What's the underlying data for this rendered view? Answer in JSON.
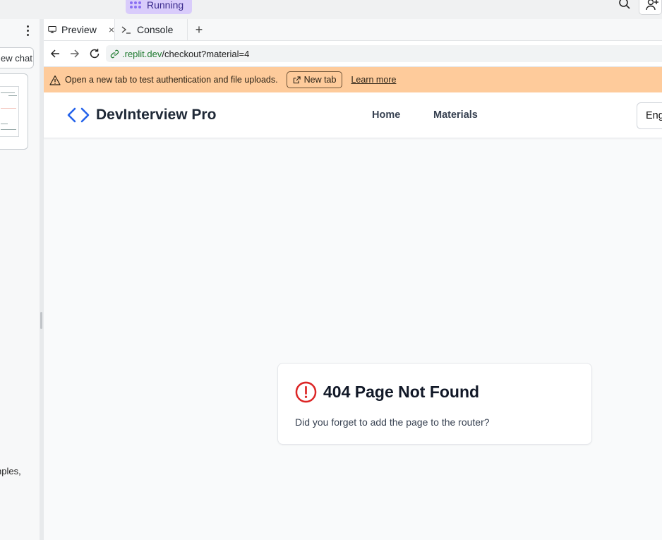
{
  "workspace": {
    "status_label": "Running"
  },
  "sidebar": {
    "new_chat_label": "ew chat",
    "snippet_text": "nples,"
  },
  "tabs": {
    "preview_label": "Preview",
    "console_label": "Console",
    "close_glyph": "×",
    "add_glyph": "+"
  },
  "browser": {
    "url_host": ".replit.dev",
    "url_path": "/checkout?material=4"
  },
  "banner": {
    "message": "Open a new tab to test authentication and file uploads.",
    "new_tab_label": "New tab",
    "learn_more_label": "Learn more",
    "color": "#fecb9b"
  },
  "app": {
    "brand_name": "DevInterview Pro",
    "brand_color": "#2563eb",
    "nav": [
      {
        "label": "Home"
      },
      {
        "label": "Materials"
      }
    ],
    "language_label": "English"
  },
  "not_found": {
    "title": "404 Page Not Found",
    "message": "Did you forget to add the page to the router?",
    "icon": "alert-circle-icon",
    "icon_color": "#dc2626"
  }
}
